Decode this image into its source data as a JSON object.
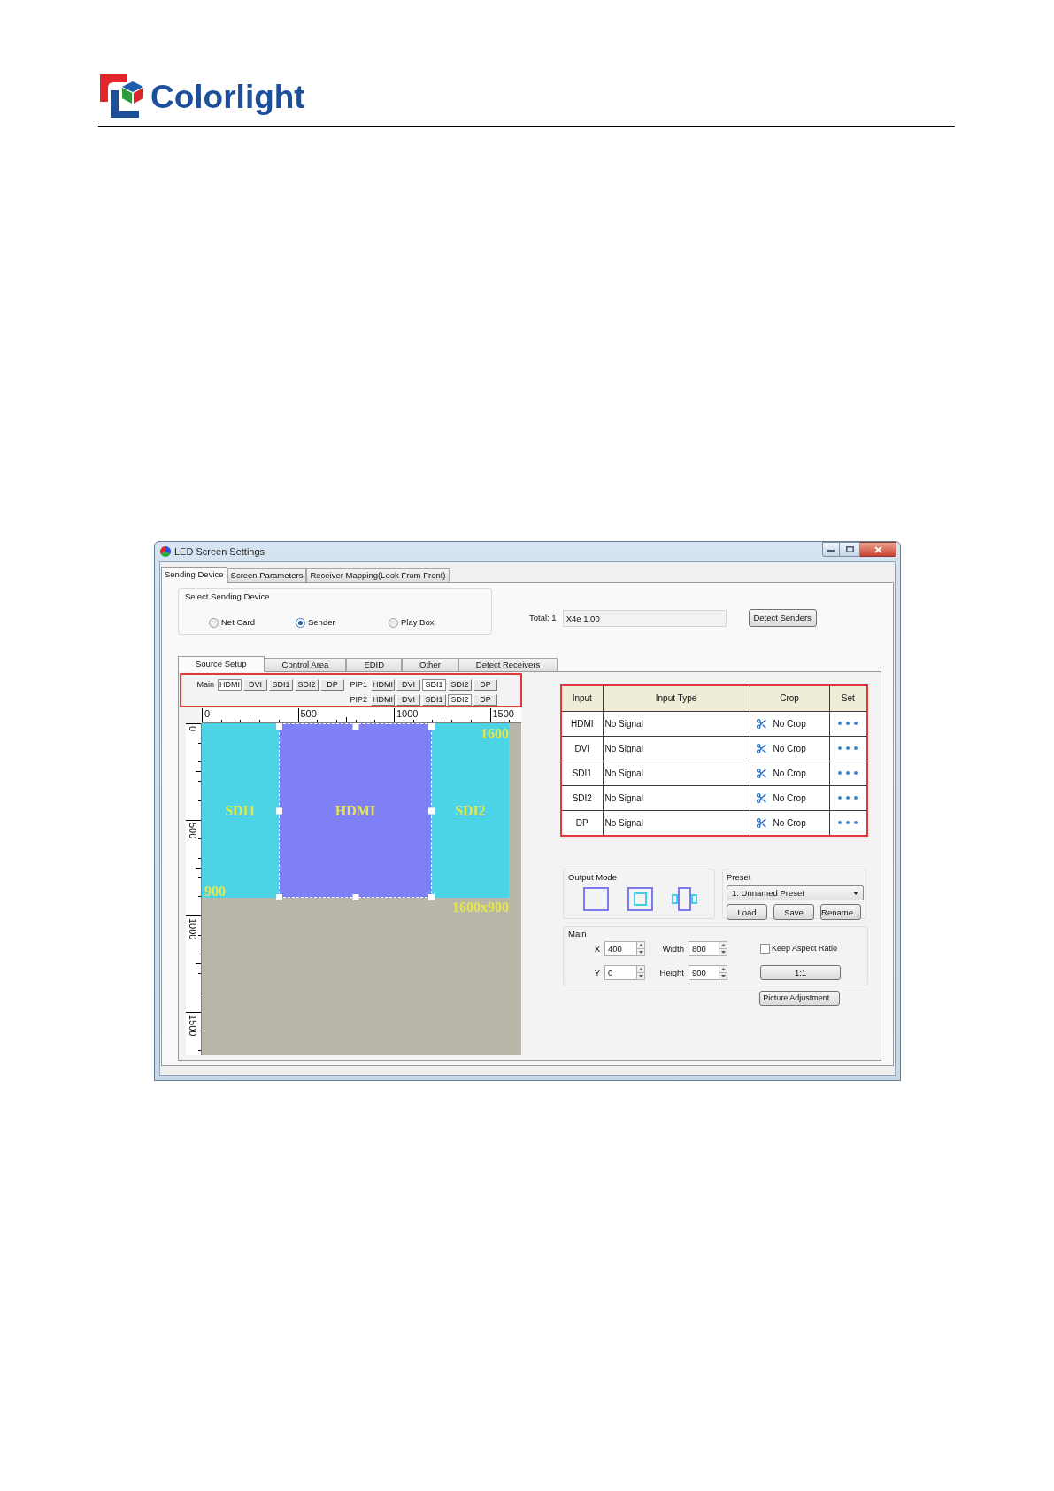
{
  "header": {
    "logo_text": "Colorlight"
  },
  "window": {
    "title": "LED Screen Settings"
  },
  "tabs": [
    {
      "label": "Sending Device",
      "selected": true
    },
    {
      "label": "Screen Parameters",
      "selected": false
    },
    {
      "label": "Receiver Mapping(Look From Front)",
      "selected": false
    }
  ],
  "sending_device": {
    "title": "Select Sending Device",
    "options": [
      {
        "label": "Net Card",
        "selected": false
      },
      {
        "label": "Sender",
        "selected": true
      },
      {
        "label": "Play Box",
        "selected": false
      }
    ],
    "total_label": "Total: 1",
    "device_field": {
      "value": "X4e 1.00"
    },
    "detect_button": "Detect Senders"
  },
  "sub_tabs": [
    {
      "label": "Source Setup",
      "selected": true
    },
    {
      "label": "Control Area",
      "selected": false
    },
    {
      "label": "EDID",
      "selected": false
    },
    {
      "label": "Other",
      "selected": false
    },
    {
      "label": "Detect Receivers",
      "selected": false
    }
  ],
  "source_rows": [
    {
      "label": "Main",
      "buttons": [
        {
          "label": "HDMI",
          "selected": true
        },
        {
          "label": "DVI",
          "selected": false
        },
        {
          "label": "SDI1",
          "selected": false
        },
        {
          "label": "SDI2",
          "selected": false
        },
        {
          "label": "DP",
          "selected": false
        }
      ]
    },
    {
      "label": "PIP1",
      "buttons": [
        {
          "label": "HDMI",
          "selected": false
        },
        {
          "label": "DVI",
          "selected": false
        },
        {
          "label": "SDI1",
          "selected": true
        },
        {
          "label": "SDI2",
          "selected": false
        },
        {
          "label": "DP",
          "selected": false
        }
      ]
    },
    {
      "label": "PIP2",
      "buttons": [
        {
          "label": "HDMI",
          "selected": false
        },
        {
          "label": "DVI",
          "selected": false
        },
        {
          "label": "SDI1",
          "selected": false
        },
        {
          "label": "SDI2",
          "selected": true
        },
        {
          "label": "DP",
          "selected": false
        }
      ]
    }
  ],
  "canvas": {
    "x_ruler": [
      "0",
      "500",
      "1000",
      "1500"
    ],
    "y_ruler": [
      "0",
      "500",
      "1000",
      "1500"
    ],
    "layers": [
      {
        "label": "SDI1",
        "kind": "pip"
      },
      {
        "label": "HDMI",
        "kind": "main"
      },
      {
        "label": "SDI2",
        "kind": "pip"
      }
    ],
    "width_label": "1600",
    "height_label": "900",
    "size_label": "1600x900"
  },
  "input_table": {
    "columns": [
      "Input",
      "Input Type",
      "Crop",
      "Set"
    ],
    "rows": [
      {
        "input": "HDMI",
        "input_type": "No Signal",
        "crop": "No Crop"
      },
      {
        "input": "DVI",
        "input_type": "No Signal",
        "crop": "No Crop"
      },
      {
        "input": "SDI1",
        "input_type": "No Signal",
        "crop": "No Crop"
      },
      {
        "input": "SDI2",
        "input_type": "No Signal",
        "crop": "No Crop"
      },
      {
        "input": "DP",
        "input_type": "No Signal",
        "crop": "No Crop"
      }
    ]
  },
  "output_mode": {
    "title": "Output Mode"
  },
  "preset": {
    "title": "Preset",
    "value": "1. Unnamed Preset",
    "buttons": [
      "Load",
      "Save",
      "Rename..."
    ]
  },
  "main": {
    "title": "Main",
    "rows": [
      {
        "fields": [
          {
            "label": "X",
            "value": "400"
          },
          {
            "label": "Width",
            "value": "800"
          }
        ],
        "control": {
          "kind": "checkbox",
          "label": "Keep Aspect Ratio",
          "checked": false
        }
      },
      {
        "fields": [
          {
            "label": "Y",
            "value": "0"
          },
          {
            "label": "Height",
            "value": "900"
          }
        ],
        "control": {
          "kind": "button",
          "label": "1:1"
        }
      }
    ]
  },
  "picture_button": {
    "label": "Picture Adjustment..."
  }
}
